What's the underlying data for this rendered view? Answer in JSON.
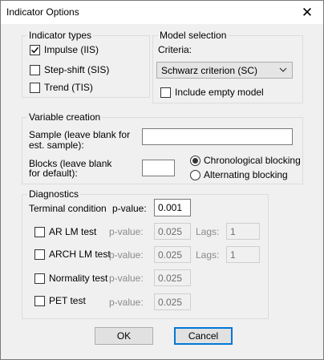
{
  "window": {
    "title": "Indicator Options",
    "close_glyph": "✕"
  },
  "indicator_types": {
    "label": "Indicator types",
    "items": [
      {
        "label": "Impulse (IIS)",
        "checked": true
      },
      {
        "label": "Step-shift (SIS)",
        "checked": false
      },
      {
        "label": "Trend (TIS)",
        "checked": false
      }
    ]
  },
  "model_selection": {
    "label": "Model selection",
    "criteria_label": "Criteria:",
    "criteria_value": "Schwarz criterion (SC)",
    "include_empty_label": "Include empty model",
    "include_empty_checked": false
  },
  "variable_creation": {
    "label": "Variable creation",
    "sample_label_line1": "Sample (leave blank for",
    "sample_label_line2": "est. sample):",
    "sample_value": "",
    "blocks_label_line1": "Blocks (leave blank",
    "blocks_label_line2": "for default):",
    "blocks_value": "",
    "blocking_options": [
      {
        "label": "Chronological blocking",
        "selected": true
      },
      {
        "label": "Alternating blocking",
        "selected": false
      }
    ]
  },
  "diagnostics": {
    "label": "Diagnostics",
    "terminal_label": "Terminal condition",
    "pvalue_label": "p-value:",
    "terminal_pvalue": "0.001",
    "lags_label": "Lags:",
    "tests": [
      {
        "label": "AR LM test",
        "checked": false,
        "pvalue": "0.025",
        "lags": "1"
      },
      {
        "label": "ARCH LM test",
        "checked": false,
        "pvalue": "0.025",
        "lags": "1"
      },
      {
        "label": "Normality test",
        "checked": false,
        "pvalue": "0.025"
      },
      {
        "label": "PET test",
        "checked": false,
        "pvalue": "0.025"
      }
    ]
  },
  "buttons": {
    "ok": "OK",
    "cancel": "Cancel"
  },
  "colors": {
    "focus_border": "#0078d7",
    "dialog_bg": "#f0f0f0"
  }
}
